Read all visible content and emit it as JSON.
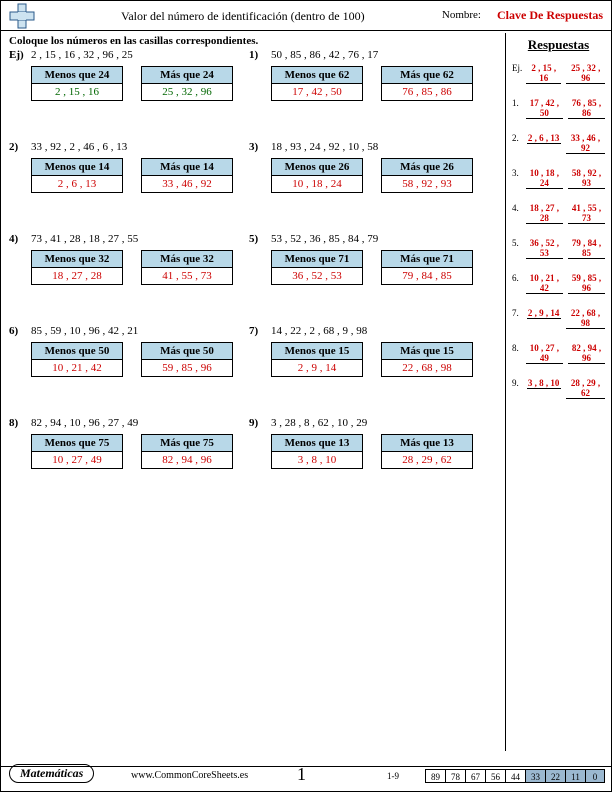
{
  "header": {
    "title": "Valor del número de identificación (dentro de 100)",
    "name_label": "Nombre:",
    "answerkey": "Clave De Respuestas"
  },
  "instruction": "Coloque los números en las casillas correspondientes.",
  "problems": [
    {
      "id": "Ej)",
      "nums": "2 , 15 , 16 , 32 , 96 , 25",
      "less_h": "Menos que 24",
      "more_h": "Más que 24",
      "less_v": "2 , 15 , 16",
      "more_v": "25 , 32 , 96",
      "color": "green"
    },
    {
      "id": "1)",
      "nums": "50 , 85 , 86 , 42 , 76 , 17",
      "less_h": "Menos que 62",
      "more_h": "Más que 62",
      "less_v": "17 , 42 , 50",
      "more_v": "76 , 85 , 86",
      "color": "red"
    },
    {
      "id": "2)",
      "nums": "33 , 92 , 2 , 46 , 6 , 13",
      "less_h": "Menos que 14",
      "more_h": "Más que 14",
      "less_v": "2 , 6 , 13",
      "more_v": "33 , 46 , 92",
      "color": "red"
    },
    {
      "id": "3)",
      "nums": "18 , 93 , 24 , 92 , 10 , 58",
      "less_h": "Menos que 26",
      "more_h": "Más que 26",
      "less_v": "10 , 18 , 24",
      "more_v": "58 , 92 , 93",
      "color": "red"
    },
    {
      "id": "4)",
      "nums": "73 , 41 , 28 , 18 , 27 , 55",
      "less_h": "Menos que 32",
      "more_h": "Más que 32",
      "less_v": "18 , 27 , 28",
      "more_v": "41 , 55 , 73",
      "color": "red"
    },
    {
      "id": "5)",
      "nums": "53 , 52 , 36 , 85 , 84 , 79",
      "less_h": "Menos que 71",
      "more_h": "Más que 71",
      "less_v": "36 , 52 , 53",
      "more_v": "79 , 84 , 85",
      "color": "red"
    },
    {
      "id": "6)",
      "nums": "85 , 59 , 10 , 96 , 42 , 21",
      "less_h": "Menos que 50",
      "more_h": "Más que 50",
      "less_v": "10 , 21 , 42",
      "more_v": "59 , 85 , 96",
      "color": "red"
    },
    {
      "id": "7)",
      "nums": "14 , 22 , 2 , 68 , 9 , 98",
      "less_h": "Menos que 15",
      "more_h": "Más que 15",
      "less_v": "2 , 9 , 14",
      "more_v": "22 , 68 , 98",
      "color": "red"
    },
    {
      "id": "8)",
      "nums": "82 , 94 , 10 , 96 , 27 , 49",
      "less_h": "Menos que 75",
      "more_h": "Más que 75",
      "less_v": "10 , 27 , 49",
      "more_v": "82 , 94 , 96",
      "color": "red"
    },
    {
      "id": "9)",
      "nums": "3 , 28 , 8 , 62 , 10 , 29",
      "less_h": "Menos que 13",
      "more_h": "Más que 13",
      "less_v": "3 , 8 , 10",
      "more_v": "28 , 29 , 62",
      "color": "red"
    }
  ],
  "answers": {
    "title": "Respuestas",
    "rows": [
      {
        "n": "Ej.",
        "a": "2 , 15 , 16",
        "b": "25 , 32 , 96"
      },
      {
        "n": "1.",
        "a": "17 , 42 , 50",
        "b": "76 , 85 , 86"
      },
      {
        "n": "2.",
        "a": "2 , 6 , 13",
        "b": "33 , 46 , 92"
      },
      {
        "n": "3.",
        "a": "10 , 18 , 24",
        "b": "58 , 92 , 93"
      },
      {
        "n": "4.",
        "a": "18 , 27 , 28",
        "b": "41 , 55 , 73"
      },
      {
        "n": "5.",
        "a": "36 , 52 , 53",
        "b": "79 , 84 , 85"
      },
      {
        "n": "6.",
        "a": "10 , 21 , 42",
        "b": "59 , 85 , 96"
      },
      {
        "n": "7.",
        "a": "2 , 9 , 14",
        "b": "22 , 68 , 98"
      },
      {
        "n": "8.",
        "a": "10 , 27 , 49",
        "b": "82 , 94 , 96"
      },
      {
        "n": "9.",
        "a": "3 , 8 , 10",
        "b": "28 , 29 , 62"
      }
    ]
  },
  "footer": {
    "brand": "Matemáticas",
    "url": "www.CommonCoreSheets.es",
    "page": "1",
    "score_label": "1-9",
    "scores": [
      "89",
      "78",
      "67",
      "56",
      "44",
      "33",
      "22",
      "11",
      "0"
    ],
    "shade_from": 5
  }
}
